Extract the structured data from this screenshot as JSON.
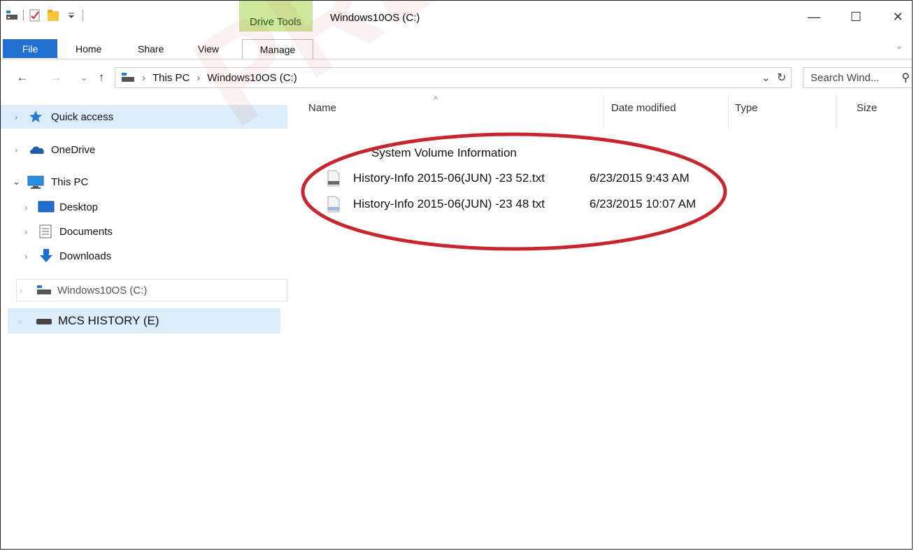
{
  "window": {
    "title": "Windows10OS (C:)",
    "context_tab": "Drive Tools",
    "minimize": "—",
    "maximize": "☐",
    "close": "✕"
  },
  "ribbon": {
    "tabs": [
      "File",
      "Home",
      "Share",
      "View",
      "Manage"
    ]
  },
  "address": {
    "back": "←",
    "forward": "→",
    "recent": "⌄",
    "up": "↑",
    "crumb_sep": "›",
    "crumbs": [
      "This PC",
      "Windows10OS (C:)"
    ],
    "dropdown": "⌄",
    "refresh": "↻",
    "search_placeholder": "Search Wind...",
    "search_icon": "⚲"
  },
  "sidebar": {
    "quick_access": "Quick access",
    "onedrive": "OneDrive",
    "this_pc": "This PC",
    "desktop": "Desktop",
    "documents": "Documents",
    "downloads": "Downloads",
    "windows_drive": "Windows10OS (C:)",
    "mcs_history": "MCS HISTORY (E)"
  },
  "columns": {
    "name": "Name",
    "sort_arrow": "^",
    "date_modified": "Date modified",
    "type": "Type",
    "size": "Size"
  },
  "files": [
    {
      "name": "System Volume Information",
      "date": ""
    },
    {
      "name": "History-Info 2015-06(JUN) -23  52.txt",
      "date": "6/23/2015 9:43 AM"
    },
    {
      "name": "History-Info 2015-06(JUN) -23  48 txt",
      "date": "6/23/2015 10:07 AM"
    }
  ],
  "watermark": "PRELIM",
  "colors": {
    "file_tab": "#1e6fd0",
    "drive_tools": "#cde89c",
    "selection": "#dcecf8",
    "annotation": "#c8262f"
  }
}
